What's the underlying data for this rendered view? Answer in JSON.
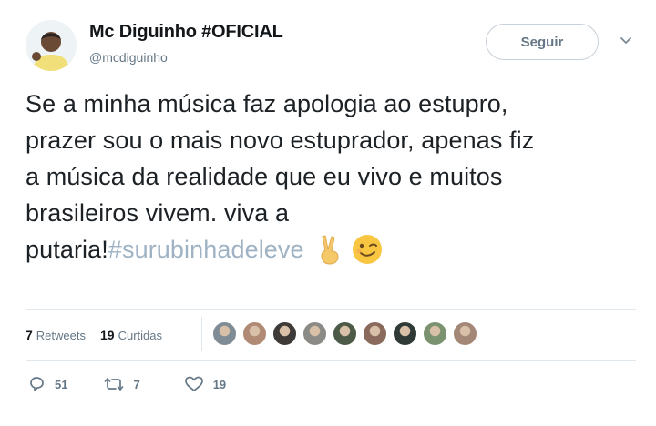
{
  "user": {
    "name": "Mc Diguinho #OFICIAL",
    "handle": "@mcdiguinho"
  },
  "follow_button": {
    "label": "Seguir"
  },
  "tweet": {
    "lines": [
      "Se a minha música faz apologia ao estupro,",
      "prazer sou o mais novo estuprador, apenas fiz",
      "a música da realidade que eu vivo e muitos",
      "brasileiros vivem. viva a"
    ],
    "last_line_text": "putaria!",
    "hashtag": "#surubinhadeleve",
    "emojis": [
      "victory-hand",
      "winking-face"
    ]
  },
  "stats": {
    "retweets_count": "7",
    "retweets_label": "Retweets",
    "likes_count": "19",
    "likes_label": "Curtidas"
  },
  "likers": [
    {
      "color": "#7f8b95"
    },
    {
      "color": "#b08a74"
    },
    {
      "color": "#3e3a38"
    },
    {
      "color": "#8c8a86"
    },
    {
      "color": "#4c5a47"
    },
    {
      "color": "#8a6a5c"
    },
    {
      "color": "#2f3a36"
    },
    {
      "color": "#7a9270"
    },
    {
      "color": "#a48877"
    }
  ],
  "actions": {
    "reply_count": "51",
    "retweet_count": "7",
    "like_count": "19"
  },
  "colors": {
    "hashtag": "#9fb3c4",
    "secondary_text": "#657786",
    "divider": "#e1e8ed"
  }
}
